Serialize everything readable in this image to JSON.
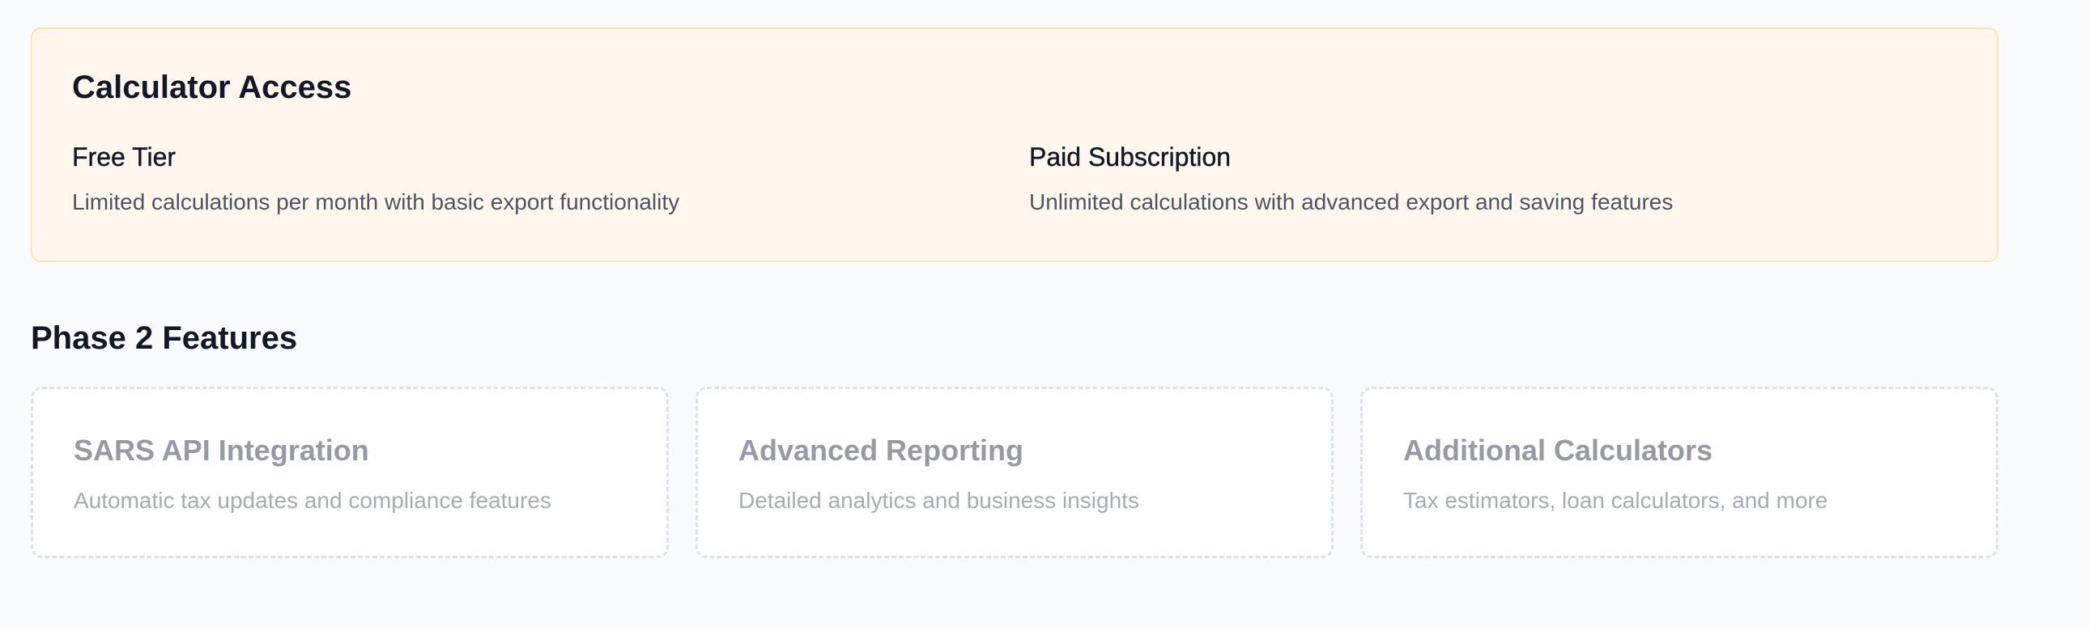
{
  "calculator_access": {
    "title": "Calculator Access",
    "tiers": [
      {
        "name": "Free Tier",
        "description": "Limited calculations per month with basic export functionality"
      },
      {
        "name": "Paid Subscription",
        "description": "Unlimited calculations with advanced export and saving features"
      }
    ],
    "colors": {
      "background": "#fff7ed",
      "border": "#fde3b4"
    }
  },
  "phase2": {
    "title": "Phase 2 Features",
    "features": [
      {
        "name": "SARS API Integration",
        "description": "Automatic tax updates and compliance features"
      },
      {
        "name": "Advanced Reporting",
        "description": "Detailed analytics and business insights"
      },
      {
        "name": "Additional Calculators",
        "description": "Tax estimators, loan calculators, and more"
      }
    ],
    "colors": {
      "card_border": "#dde1e8",
      "muted_text": "#949aa6"
    }
  }
}
